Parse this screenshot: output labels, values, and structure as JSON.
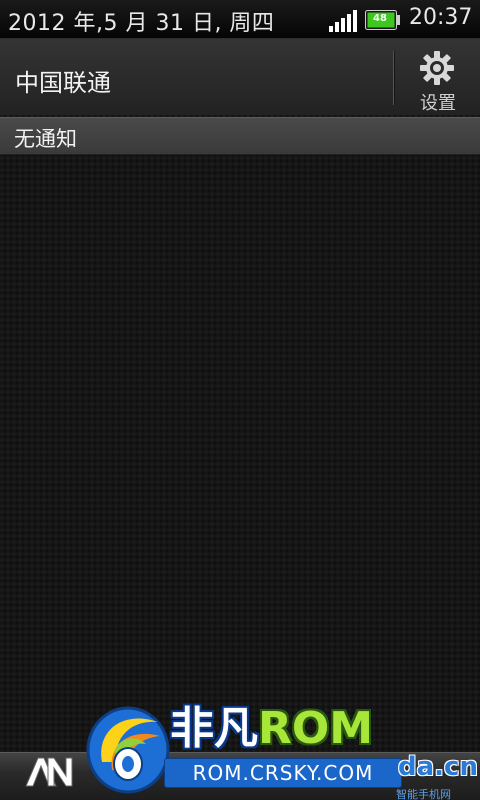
{
  "status_bar": {
    "date": "2012 年,5 月 31 日, 周四",
    "battery_level": "48",
    "time": "20:37"
  },
  "header": {
    "carrier": "中国联通",
    "settings_label": "设置",
    "settings_icon": "gear-icon"
  },
  "notifications": {
    "title": "无通知"
  },
  "watermark": {
    "brand_cn": "非凡",
    "brand_rom": "ROM",
    "url": "ROM.CRSKY.COM",
    "site": "da.cn",
    "tagline": "智能手机网"
  },
  "colors": {
    "background": "#151515",
    "section_header": "#404040",
    "text": "#f2f2f2",
    "battery_green": "#3cc81e"
  }
}
